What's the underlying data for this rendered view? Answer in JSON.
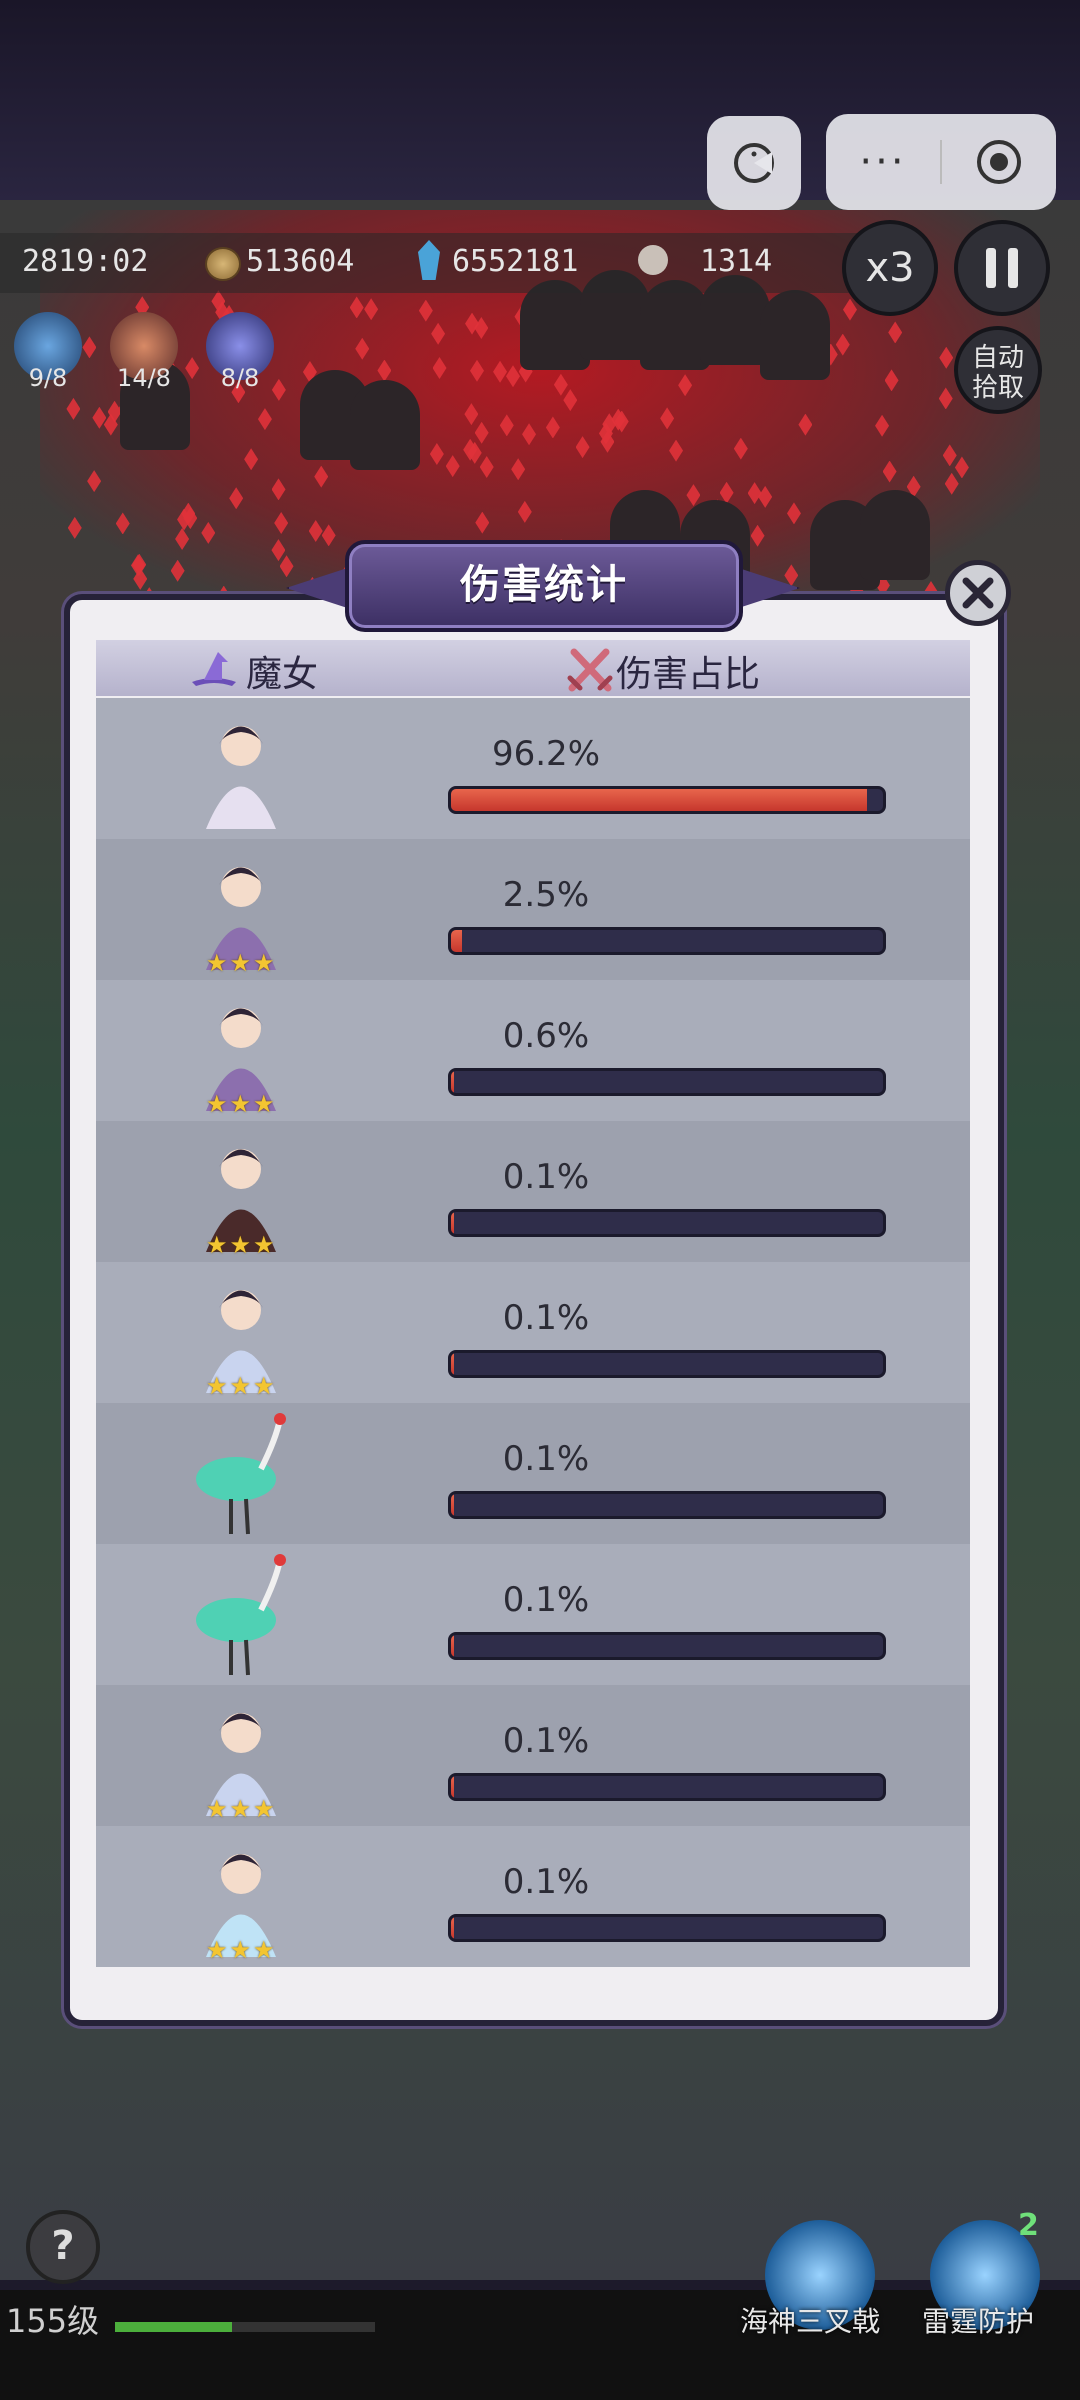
{
  "capsule": {
    "more_label": "···"
  },
  "hud": {
    "timer": "2819:02",
    "coins": "513604",
    "crystals": "6552181",
    "kills": "1314",
    "speed_label": "x3",
    "auto_pick_line1": "自动",
    "auto_pick_line2": "拾取",
    "skills": [
      {
        "count": "9/8"
      },
      {
        "count": "14/8"
      },
      {
        "count": "8/8"
      }
    ]
  },
  "panel": {
    "title": "伤害统计",
    "col_witch": "魔女",
    "col_share": "伤害占比",
    "rows": [
      {
        "name": "angel-witch",
        "percent_label": "96.2%",
        "share": 0.962,
        "stars": 0,
        "color": "#e6e0f0"
      },
      {
        "name": "horned-witch",
        "percent_label": "2.5%",
        "share": 0.025,
        "stars": 3,
        "color": "#8c6fae"
      },
      {
        "name": "horned-witch",
        "percent_label": "0.6%",
        "share": 0.006,
        "stars": 3,
        "color": "#8c6fae"
      },
      {
        "name": "hooded-witch",
        "percent_label": "0.1%",
        "share": 0.001,
        "stars": 3,
        "color": "#4a2a2a"
      },
      {
        "name": "silver-witch",
        "percent_label": "0.1%",
        "share": 0.001,
        "stars": 3,
        "color": "#c9d4ef"
      },
      {
        "name": "crane",
        "percent_label": "0.1%",
        "share": 0.001,
        "stars": 0,
        "color": "#4fd1b4"
      },
      {
        "name": "crane",
        "percent_label": "0.1%",
        "share": 0.001,
        "stars": 0,
        "color": "#4fd1b4"
      },
      {
        "name": "silver-witch",
        "percent_label": "0.1%",
        "share": 0.001,
        "stars": 3,
        "color": "#c9d4ef"
      },
      {
        "name": "ice-witch",
        "percent_label": "0.1%",
        "share": 0.001,
        "stars": 3,
        "color": "#bfe3f6"
      }
    ]
  },
  "bottom": {
    "help_label": "?",
    "level_label": "155级",
    "level_progress": 0.45,
    "skill1_label": "海神三叉戟",
    "skill2_label": "雷霆防护",
    "skill2_badge": "2"
  }
}
